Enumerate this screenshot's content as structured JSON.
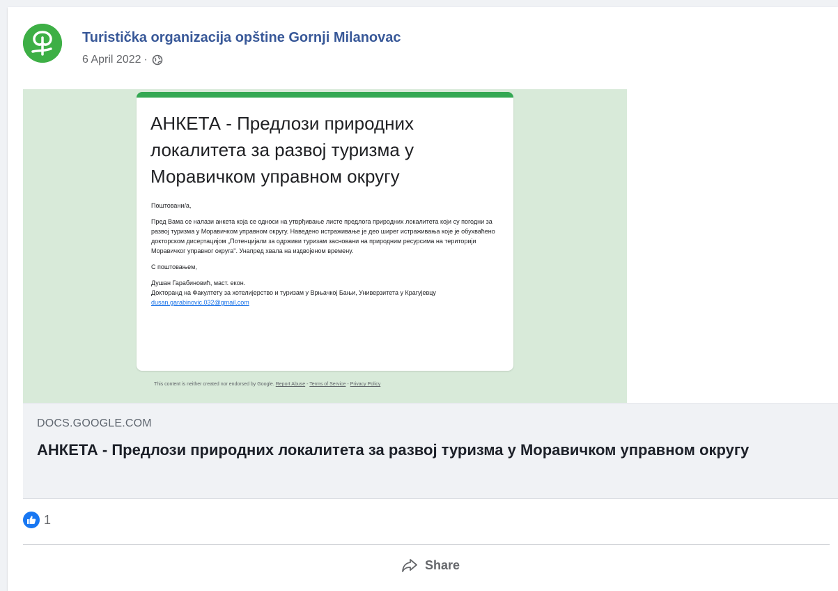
{
  "post": {
    "page_name": "Turistička organizacija opštine Gornji Milanovac",
    "date": "6 April 2022",
    "separator": "·",
    "privacy_icon": "globe-icon",
    "avatar_icon": "leaf-logo-icon"
  },
  "preview": {
    "form_title": "АНКЕТА - Предлози природних локалитета за развој туризма у Моравичком управном округу",
    "greeting": "Поштовани/а,",
    "paragraph": "Пред Вама се налази анкета која се односи на утврђивање листе предлога природних локалитета који су погодни за развој туризма у Моравичком управном округу. Наведено истраживање је део ширег истраживања које је обухваћено докторском дисертацијом „Потенцијали за одрживи туризам засновани на природним ресурсима на територији Моравичког управног округа\". Унапред хвала на издвојеном времену.",
    "regards": "С поштовањем,",
    "author": "Душан Гарабиновић, маст. екон.",
    "affiliation": "Докторанд на Факултету за хотелијерство и туризам у Врњачкој Бањи, Универзитета у Крагујевцу",
    "email": "dusan.garabinovic.032@gmail.com",
    "footer_text": "This content is neither created nor endorsed by Google.",
    "footer_report": "Report Abuse",
    "footer_dash1": "-",
    "footer_terms": "Terms of Service",
    "footer_dash2": "-",
    "footer_privacy": "Privacy Policy"
  },
  "link": {
    "domain": "DOCS.GOOGLE.COM",
    "title": "АНКЕТА - Предлози природних локалитета за развој туризма у Моравичком управном округу"
  },
  "reactions": {
    "icon": "like-icon",
    "count": "1"
  },
  "actions": {
    "share_label": "Share",
    "share_icon": "share-arrow-icon"
  },
  "colors": {
    "page_name": "#385898",
    "avatar_bg": "#3daf45",
    "form_accent": "#34a853",
    "preview_bg": "#d8ead9",
    "like_blue": "#1877f2"
  }
}
